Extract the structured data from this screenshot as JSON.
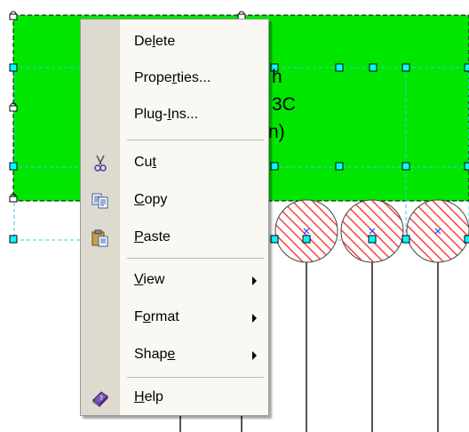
{
  "menu": {
    "items": [
      {
        "id": "delete",
        "pre": "De",
        "acc": "l",
        "post": "ete",
        "icon": null,
        "submenu": false
      },
      {
        "id": "properties",
        "pre": "Prope",
        "acc": "r",
        "post": "ties...",
        "icon": null,
        "submenu": false
      },
      {
        "id": "plug-ins",
        "pre": "Plug-",
        "acc": "I",
        "post": "ns...",
        "icon": null,
        "submenu": false
      },
      {
        "id": "cut",
        "pre": "Cu",
        "acc": "t",
        "post": "",
        "icon": "scissors-icon",
        "submenu": false
      },
      {
        "id": "copy",
        "pre": "",
        "acc": "C",
        "post": "opy",
        "icon": "copy-icon",
        "submenu": false
      },
      {
        "id": "paste",
        "pre": "",
        "acc": "P",
        "post": "aste",
        "icon": "paste-icon",
        "submenu": false
      },
      {
        "id": "view",
        "pre": "",
        "acc": "V",
        "post": "iew",
        "icon": null,
        "submenu": true
      },
      {
        "id": "format",
        "pre": "F",
        "acc": "o",
        "post": "rmat",
        "icon": null,
        "submenu": true
      },
      {
        "id": "shape",
        "pre": "Shap",
        "acc": "e",
        "post": "",
        "icon": null,
        "submenu": true
      },
      {
        "id": "help",
        "pre": "",
        "acc": "H",
        "post": "elp",
        "icon": "help-book-icon",
        "submenu": false
      }
    ]
  },
  "diagram": {
    "shape_text": [
      "h",
      "3C",
      "n)"
    ],
    "colors": {
      "fill": "#00e600",
      "handle": "#00ffff",
      "hatch": "#ff3b3b",
      "line": "#333333"
    }
  }
}
